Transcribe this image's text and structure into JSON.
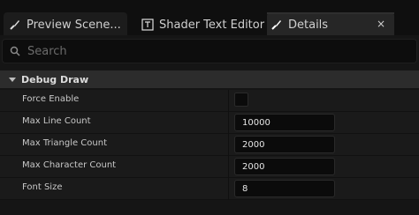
{
  "tabs": [
    {
      "label": "Preview Scene...",
      "icon": "settings-brush-icon"
    },
    {
      "label": "Shader Text Editor",
      "icon": "shader-text-editor-icon"
    },
    {
      "label": "Details",
      "icon": "settings-brush-icon",
      "active": true,
      "close": "×"
    }
  ],
  "search": {
    "placeholder": "Search",
    "value": ""
  },
  "category": {
    "label": "Debug Draw",
    "expanded": true
  },
  "properties": [
    {
      "label": "Force Enable",
      "type": "checkbox",
      "checked": false
    },
    {
      "label": "Max Line Count",
      "type": "number",
      "value": "10000"
    },
    {
      "label": "Max Triangle Count",
      "type": "number",
      "value": "2000"
    },
    {
      "label": "Max Character Count",
      "type": "number",
      "value": "2000"
    },
    {
      "label": "Font Size",
      "type": "number",
      "value": "8"
    }
  ]
}
